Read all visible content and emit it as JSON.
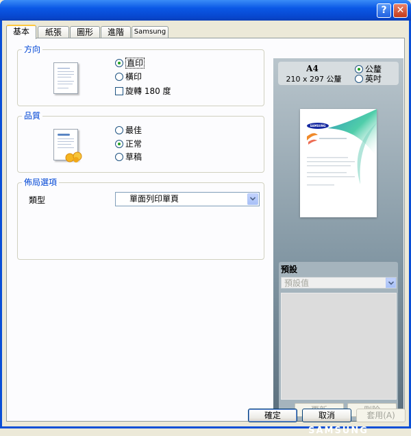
{
  "titlebar": {
    "help_label": "?",
    "close_label": "✕"
  },
  "tabs": [
    {
      "label": "基本",
      "active": true
    },
    {
      "label": "紙張",
      "active": false
    },
    {
      "label": "圖形",
      "active": false
    },
    {
      "label": "進階",
      "active": false
    },
    {
      "label": "Samsung",
      "active": false
    }
  ],
  "orientation": {
    "title": "方向",
    "options": [
      {
        "label": "直印",
        "selected": true
      },
      {
        "label": "橫印",
        "selected": false
      }
    ],
    "rotate_label": "旋轉 180 度",
    "rotate_checked": false
  },
  "quality": {
    "title": "品質",
    "options": [
      {
        "label": "最佳",
        "selected": false
      },
      {
        "label": "正常",
        "selected": true
      },
      {
        "label": "草稿",
        "selected": false
      }
    ]
  },
  "layout": {
    "title": "佈局選項",
    "type_label": "類型",
    "type_value": "單面列印單頁"
  },
  "preview": {
    "paper_size": "A4",
    "paper_dims": "210 x 297 公釐",
    "units": [
      {
        "label": "公釐",
        "selected": true
      },
      {
        "label": "英吋",
        "selected": false
      }
    ],
    "thumb_logo": "SAMSUNG",
    "favorites": {
      "title": "預設",
      "select_value": "預設值",
      "update_label": "更新",
      "delete_label": "刪除"
    },
    "brand": "SAMSUNG"
  },
  "buttons": {
    "ok": "確定",
    "cancel": "取消",
    "apply": "套用(A)"
  },
  "colors": {
    "title_blue": "#0a58e6",
    "group_label": "#0046d5",
    "radio_dot": "#21a121"
  }
}
